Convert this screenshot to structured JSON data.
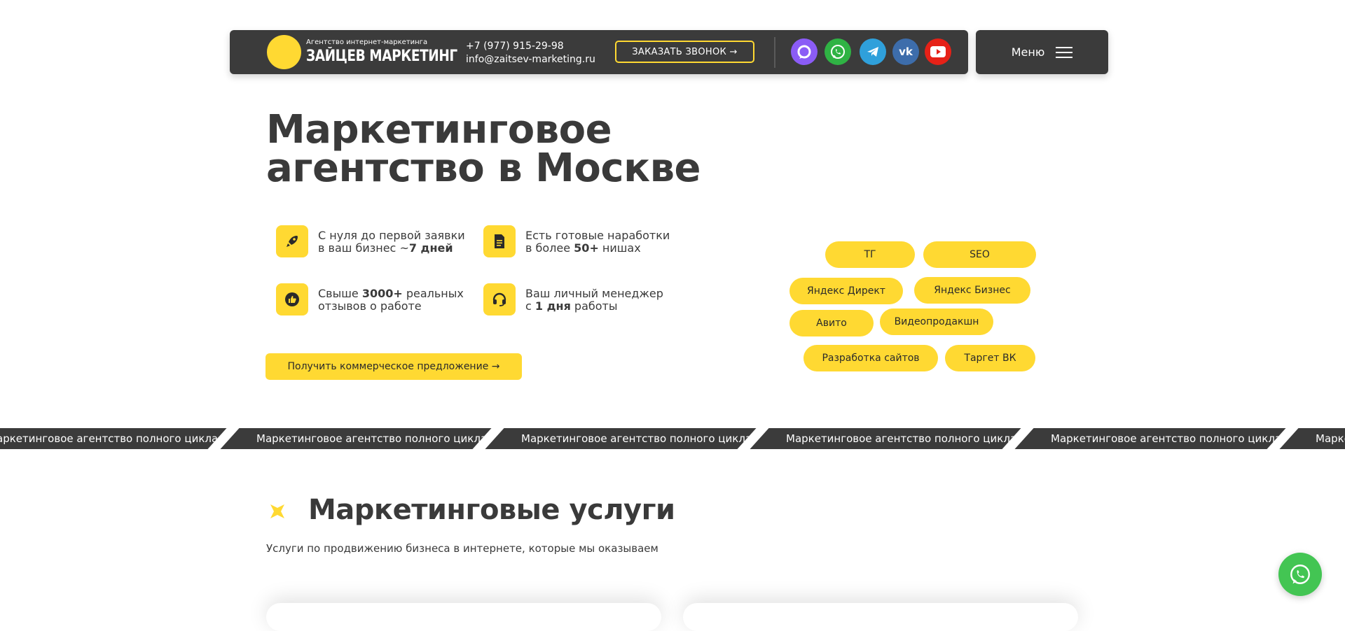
{
  "header": {
    "logo_sub": "Агентство интернет-маркетинга",
    "logo_main": "ЗАЙЦЕВ МАРКЕТИНГ",
    "phone": "+7 (977) 915-29-98",
    "email": "info@zaitsev-marketing.ru",
    "call_button": "ЗАКАЗАТЬ ЗВОНОК →",
    "menu_label": "Меню",
    "social_icons": [
      "max-icon",
      "whatsapp-icon",
      "telegram-icon",
      "vk-icon",
      "youtube-icon"
    ]
  },
  "hero": {
    "title_line1": "Маркетинговое",
    "title_line2": "агентство в Москве",
    "features": [
      {
        "icon": "rocket-icon",
        "l1": "С нуля до первой заявки",
        "l2_pre": "в ваш бизнес ~",
        "l2_bold": "7 дней",
        "l2_post": ""
      },
      {
        "icon": "document-icon",
        "l1": "Есть готовые наработки",
        "l2_pre": "в более ",
        "l2_bold": "50+",
        "l2_post": " нишах"
      },
      {
        "icon": "thumbs-up-icon",
        "l1_pre": "Свыше ",
        "l1_bold": "3000+",
        "l1_post": " реальных",
        "l2": "отзывов о работе"
      },
      {
        "icon": "headset-icon",
        "l1": "Ваш личный менеджер",
        "l2_pre": "с ",
        "l2_bold": "1 дня",
        "l2_post": " работы"
      }
    ],
    "cta": "Получить коммерческое предложение →",
    "tags": [
      "ТГ",
      "SEO",
      "Яндекс Директ",
      "Яндекс Бизнес",
      "Авито",
      "Видеопродакшн",
      "Разработка сайтов",
      "Таргет ВК"
    ]
  },
  "ticker": {
    "items": [
      "аркетинговое агентство полного цикла",
      "Маркетинговое агентство полного цикла",
      "Маркетинговое агентство полного цикла",
      "Маркетинговое агентство полного цикла",
      "Маркетинговое агентство полного цикла",
      "Марке"
    ]
  },
  "services": {
    "title": "Маркетинговые услуги",
    "subtitle": "Услуги по продвижению бизнеса в интернете, которые мы оказываем"
  },
  "colors": {
    "accent": "#ffd932",
    "dark": "#3b3b3b",
    "whatsapp": "#43c553"
  }
}
